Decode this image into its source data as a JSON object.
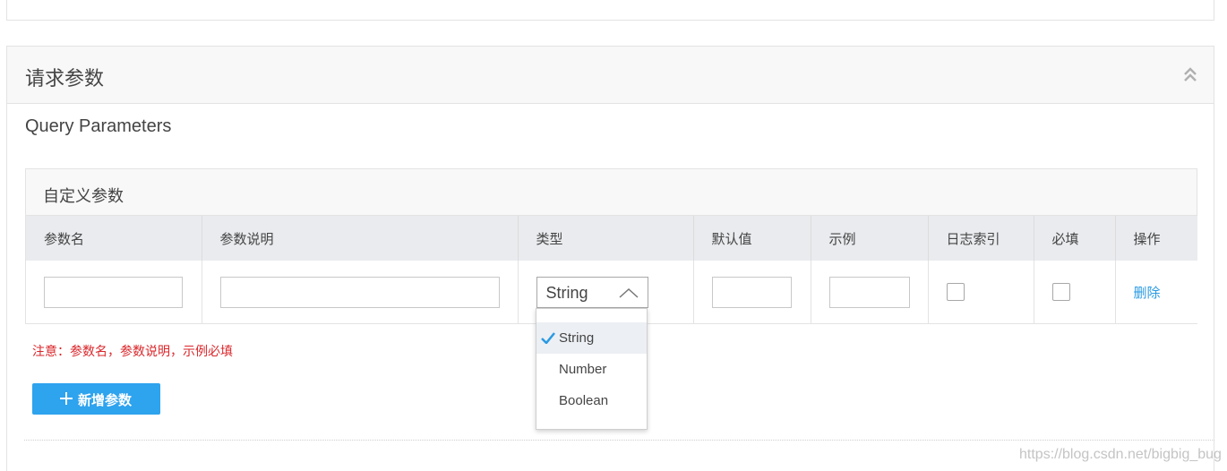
{
  "panel": {
    "title": "请求参数"
  },
  "section": {
    "title": "Query Parameters"
  },
  "custom_params": {
    "title": "自定义参数",
    "columns": [
      "参数名",
      "参数说明",
      "类型",
      "默认值",
      "示例",
      "日志索引",
      "必填",
      "操作"
    ],
    "row": {
      "name_value": "",
      "desc_value": "",
      "type_selected": "String",
      "default_value": "",
      "example_value": "",
      "log_index_checked": false,
      "required_checked": false,
      "delete_label": "删除"
    }
  },
  "type_options": [
    "String",
    "Number",
    "Boolean"
  ],
  "note": "注意：参数名，参数说明，示例必填",
  "add_button_label": "新增参数",
  "watermark": "https://blog.csdn.net/bigbig_bug",
  "colors": {
    "accent": "#2ea3ee",
    "link": "#2a9ae3",
    "warning": "#d9262a",
    "header_bg": "#e9ebee"
  },
  "icons": {
    "collapse": "double-chevron-up-icon",
    "select_arrow": "chevron-up-icon",
    "add": "plus-icon",
    "selected": "check-icon"
  }
}
